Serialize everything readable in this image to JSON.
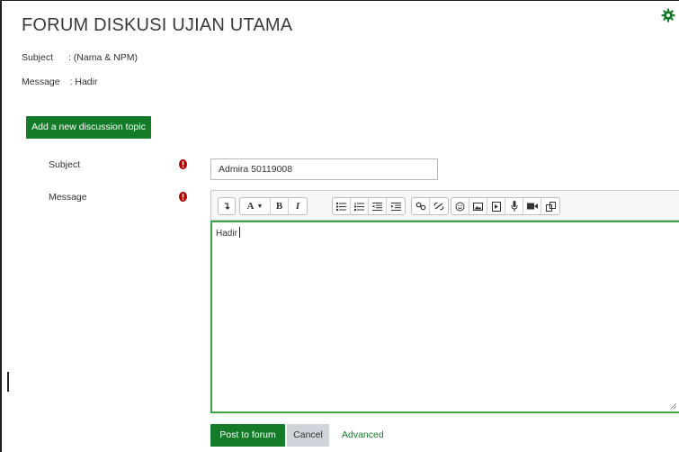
{
  "page": {
    "title": "FORUM DISKUSI UJIAN UTAMA",
    "info": [
      {
        "label": "Subject",
        "sep": ":",
        "value": "(Nama & NPM)"
      },
      {
        "label": "Message",
        "sep": ":",
        "value": "Hadir"
      }
    ]
  },
  "actions": {
    "add_topic_label": "Add a new discussion topic",
    "post_label": "Post to forum",
    "cancel_label": "Cancel",
    "advanced_label": "Advanced"
  },
  "form": {
    "subject_label": "Subject",
    "subject_value": "Admira 50119008",
    "message_label": "Message",
    "message_value": "Hadir"
  },
  "toolbar": {
    "groups": [
      [
        "collapse-icon"
      ],
      [
        "font-style-icon",
        "bold-icon",
        "italic-icon"
      ],
      [
        "unordered-list-icon",
        "ordered-list-icon",
        "outdent-icon",
        "indent-icon"
      ],
      [
        "link-icon",
        "unlink-icon"
      ],
      [
        "emoji-icon",
        "image-icon",
        "media-icon",
        "record-audio-icon",
        "record-video-icon",
        "manage-files-icon"
      ]
    ],
    "font_label": "A",
    "bold_label": "B",
    "italic_label": "I"
  },
  "colors": {
    "primary": "#147b29",
    "focus_border": "#3aa743",
    "required": "#b20000",
    "cancel_bg": "#ced4da"
  }
}
